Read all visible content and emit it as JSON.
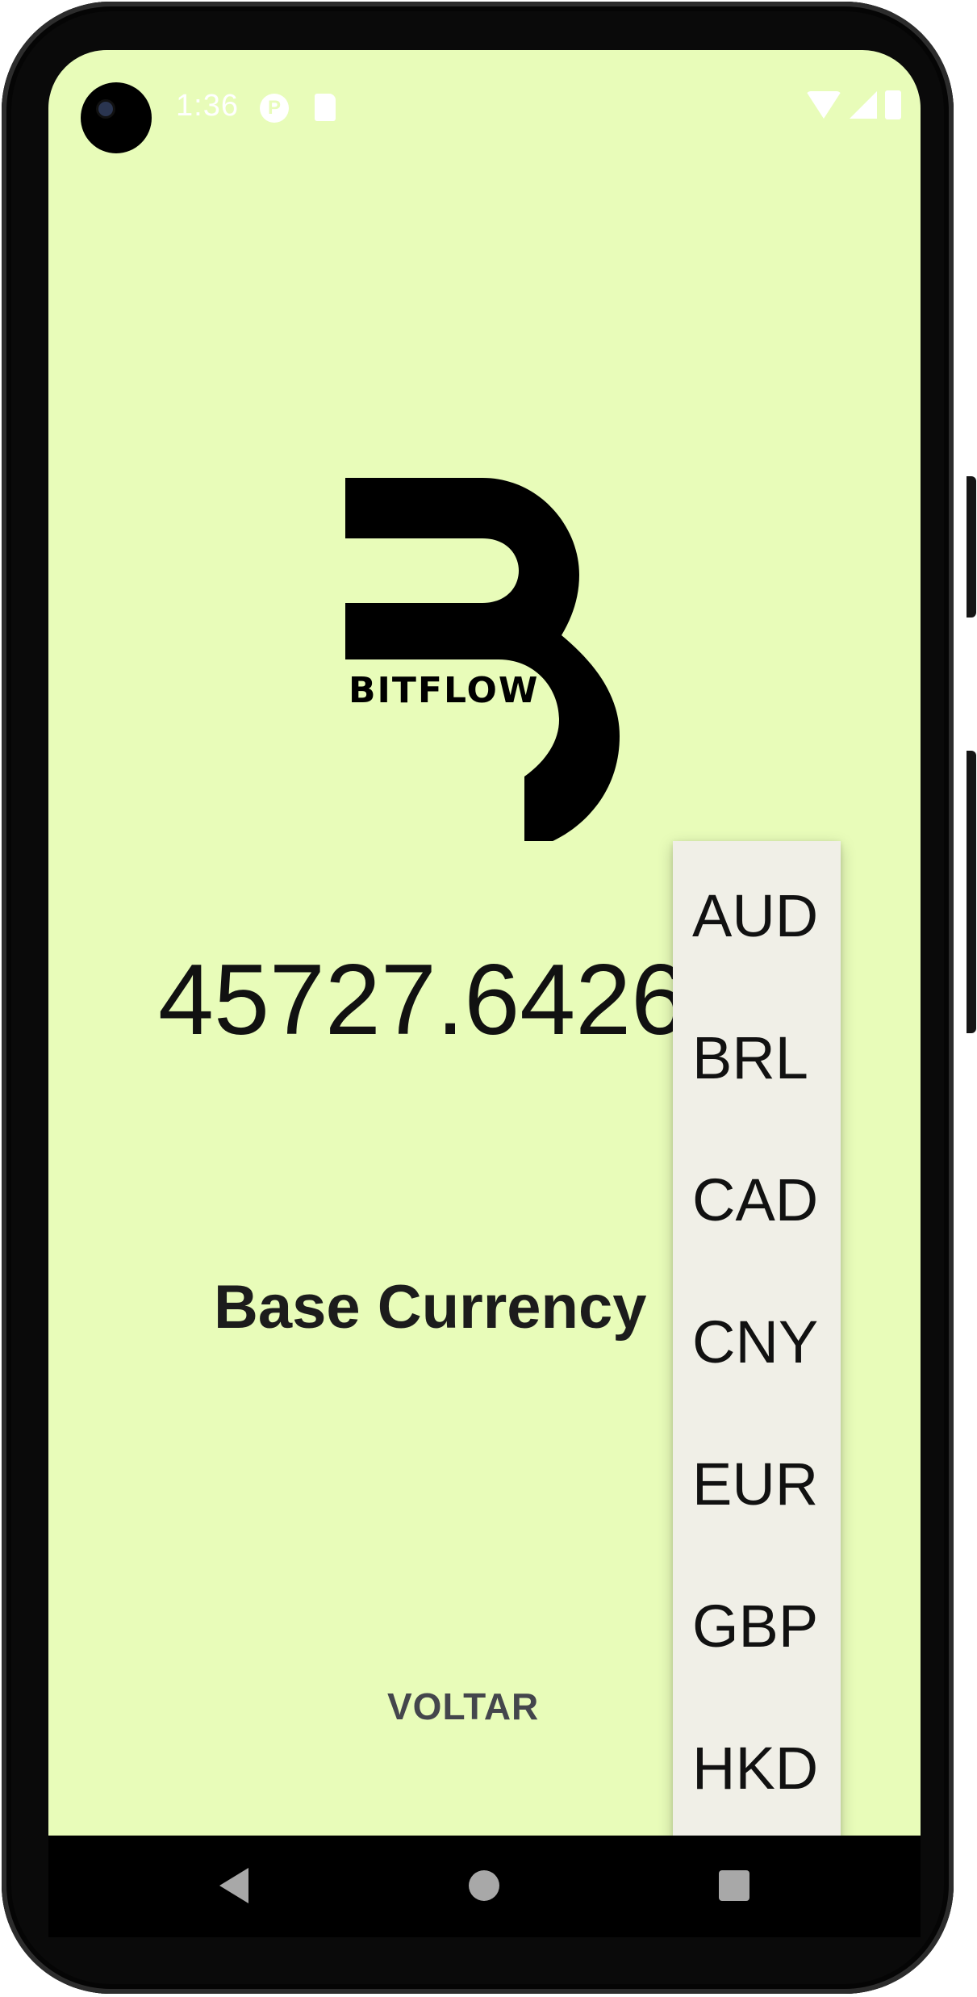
{
  "status_bar": {
    "time": "1:36",
    "icons": [
      "camera-cutout",
      "app-notification-icon",
      "sd-card-icon",
      "wifi-icon",
      "signal-icon",
      "battery-icon"
    ]
  },
  "logo": {
    "text": "BITFLOW",
    "icon": "bitflow-b-logo"
  },
  "rate": {
    "value": "45727.6426"
  },
  "base_currency": {
    "label": "Base Currency"
  },
  "back_button": {
    "label": "VOLTAR"
  },
  "currency_dropdown": {
    "options": [
      "AUD",
      "BRL",
      "CAD",
      "CNY",
      "EUR",
      "GBP",
      "HKD"
    ]
  },
  "nav_bar": {
    "icons": [
      "back-icon",
      "home-icon",
      "recent-apps-icon"
    ]
  },
  "colors": {
    "background": "#e8fcb9",
    "dropdown_background": "#f0efe7",
    "button_text": "#44464c"
  }
}
